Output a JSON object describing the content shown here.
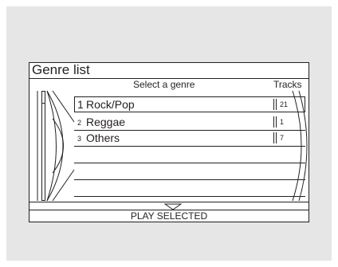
{
  "screen": {
    "title": "Genre list",
    "subtitle": "Select a genre",
    "tracks_header": "Tracks",
    "footer": "PLAY SELECTED"
  },
  "genres": [
    {
      "number": "1",
      "name": "Rock/Pop",
      "tracks": "21",
      "selected": true
    },
    {
      "number": "2",
      "name": "Reggae",
      "tracks": "1",
      "selected": false
    },
    {
      "number": "3",
      "name": "Others",
      "tracks": "7",
      "selected": false
    }
  ],
  "icons": {
    "scroll_down": "down-triangle-icon",
    "disc": "disc-arc-icon"
  }
}
